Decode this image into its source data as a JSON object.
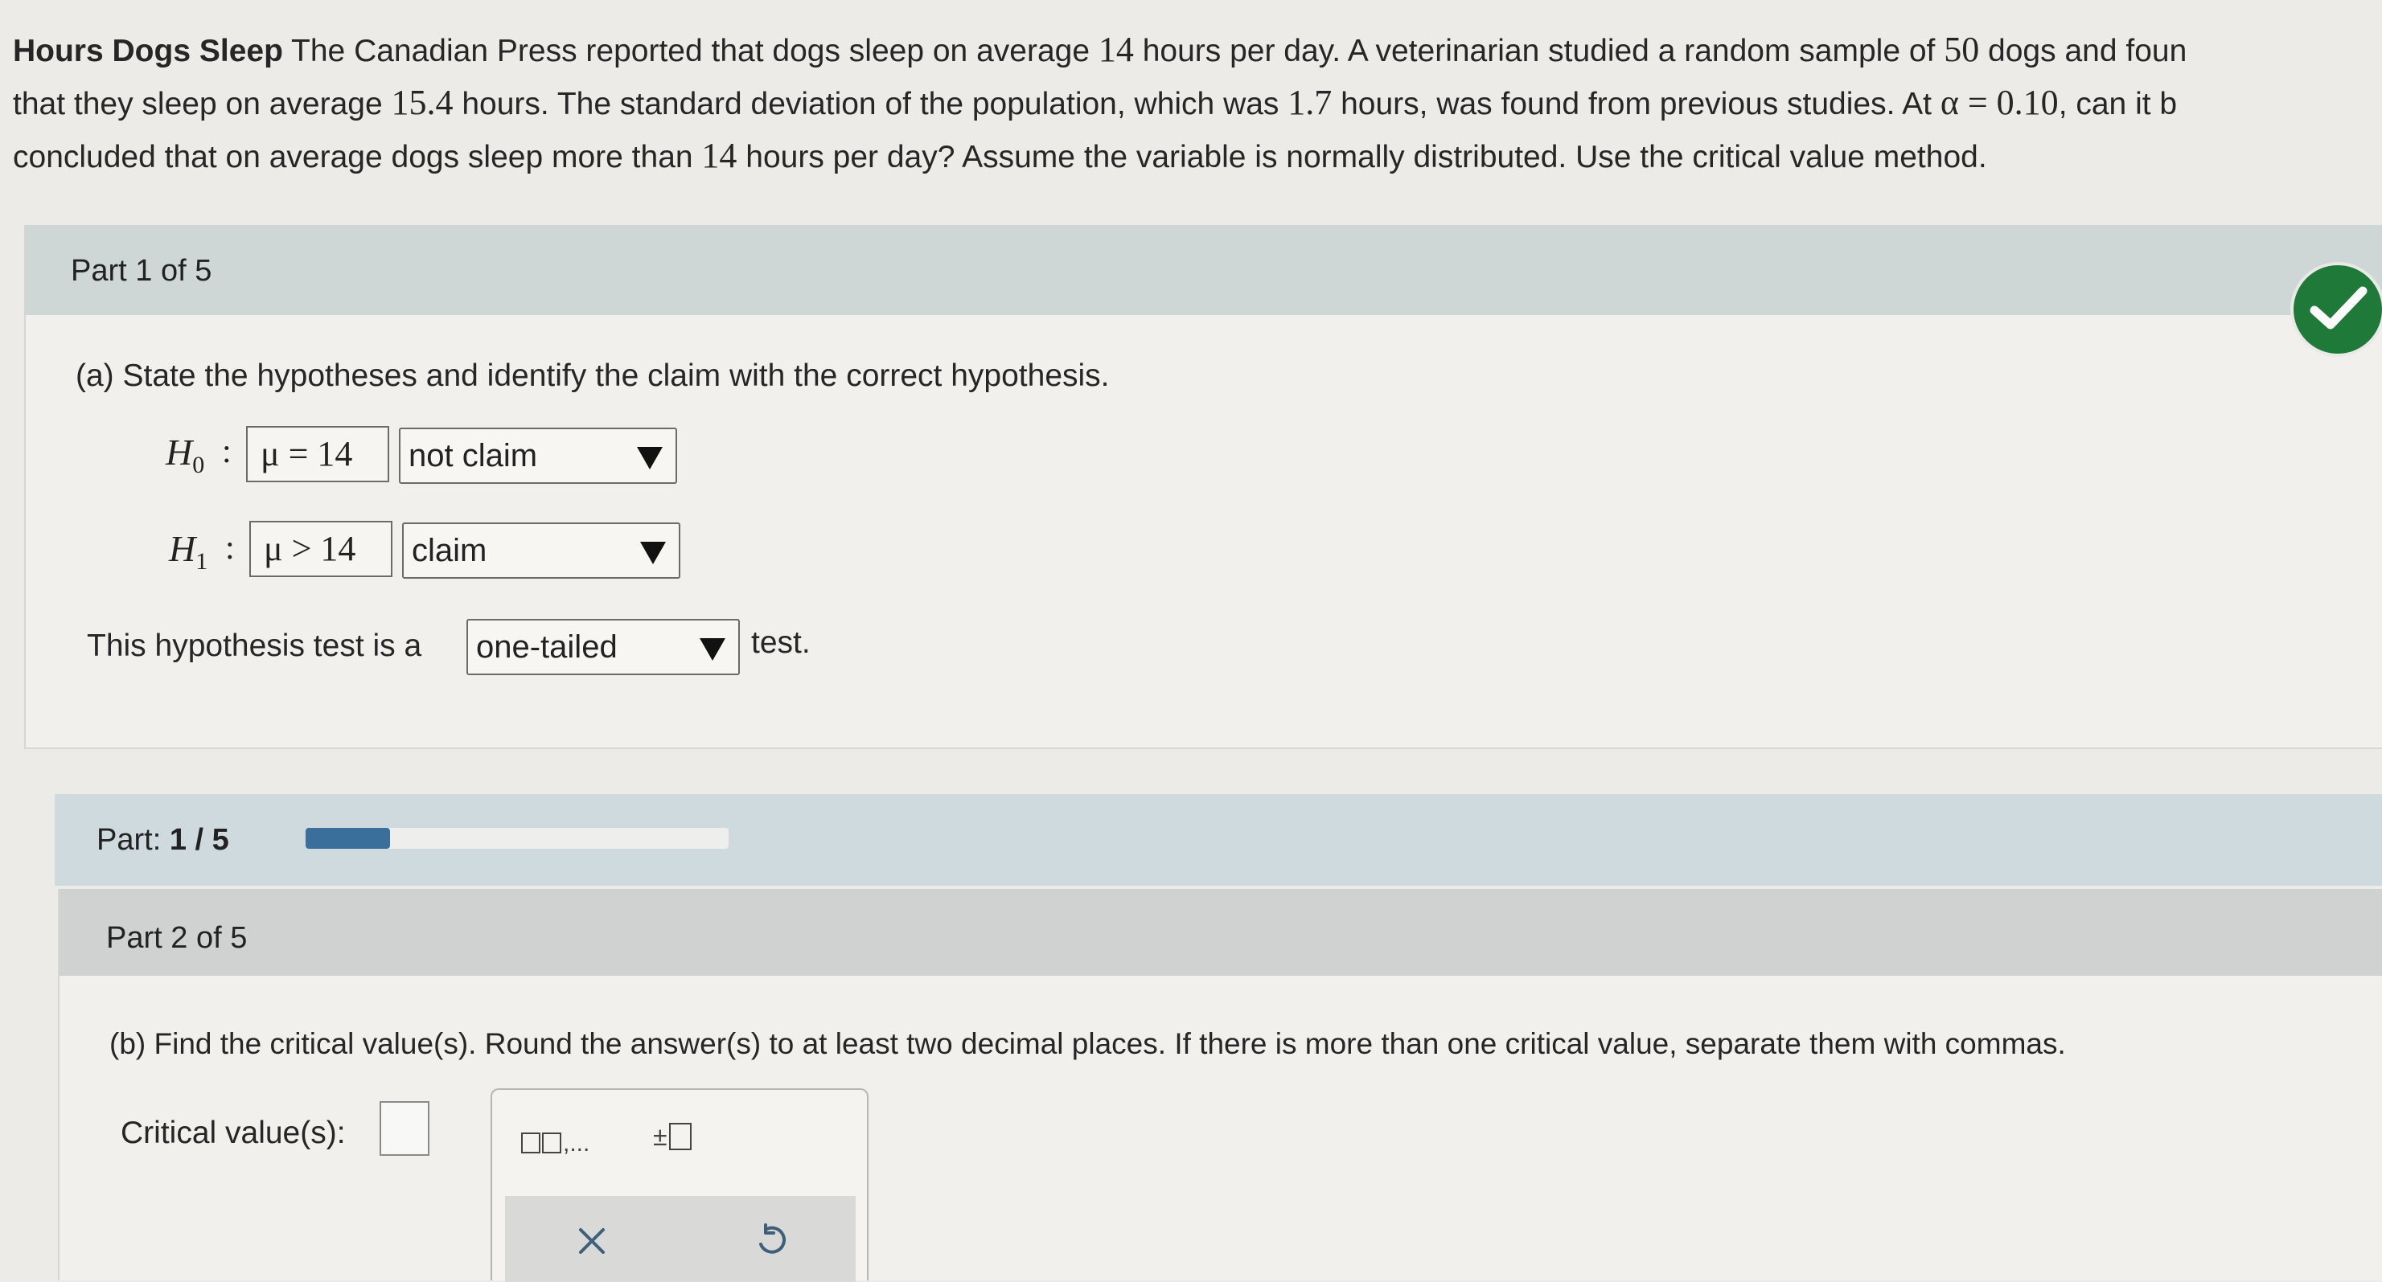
{
  "problem": {
    "title": "Hours Dogs Sleep",
    "seg1": " The Canadian Press reported that dogs sleep on average ",
    "n_hours": "14",
    "seg2": " hours per day. A veterinarian studied a random sample of ",
    "n_sample": "50",
    "seg3": " dogs and foun",
    "seg4": "that they sleep on average ",
    "n_mean": "15.4",
    "seg5": " hours. The standard deviation of the population, which was ",
    "n_sd": "1.7",
    "seg6": " hours, was found from previous studies. At ",
    "n_alpha": "α = 0.10",
    "seg7": ", can it b",
    "seg8": "concluded that on average dogs sleep more than ",
    "n_hours2": "14",
    "seg9": " hours per day? Assume the variable is normally distributed. Use the critical value method."
  },
  "part1": {
    "title": "Part 1 of 5",
    "question": "(a) State the hypotheses and identify the claim with the correct hypothesis.",
    "h0_label": "H",
    "h0_sub": "0",
    "h0_value": "μ = 14",
    "h0_claim": "not claim",
    "h1_label": "H",
    "h1_sub": "1",
    "h1_value": "μ > 14",
    "h1_claim": "claim",
    "test_prefix": "This hypothesis test is a",
    "test_type": "one-tailed",
    "test_suffix": "test.",
    "status_icon": "check-icon",
    "status_color": "#1f7a3a"
  },
  "progress": {
    "label": "Part:",
    "value": "1 / 5",
    "fraction": 0.2,
    "fill_color": "#3b6f9b"
  },
  "part2": {
    "title": "Part 2 of 5",
    "question": "(b) Find the critical value(s). Round the answer(s) to at least two decimal places. If there is more than one critical value, separate them with commas.",
    "cv_label": "Critical value(s):",
    "keypad_list": ",...",
    "keypad_pm": "±"
  }
}
